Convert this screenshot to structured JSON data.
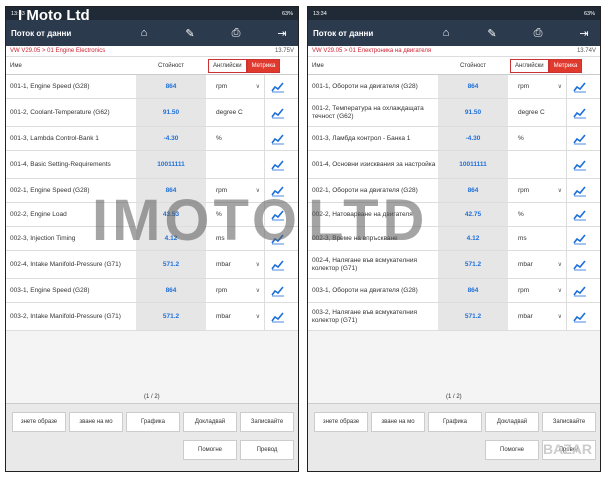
{
  "left": {
    "status_time": "13:33",
    "status_battery": "63%",
    "title": "Поток от данни",
    "crumb": "VW V29.05 > 01 Engine Electronics",
    "voltage": "13.75V",
    "header": {
      "name": "Име",
      "value": "Стойност",
      "english": "Английски",
      "metric": "Метрика"
    },
    "rows": [
      {
        "name": "001-1, Engine Speed (G28)",
        "value": "864",
        "unit": "rpm",
        "dropdown": true
      },
      {
        "name": "001-2, Coolant-Temperature (G62)",
        "value": "91.50",
        "unit": "degree C",
        "dropdown": false
      },
      {
        "name": "001-3, Lambda Control-Bank 1",
        "value": "-4.30",
        "unit": "%",
        "dropdown": false
      },
      {
        "name": "001-4, Basic Setting-Requirements",
        "value": "10011111",
        "unit": "",
        "dropdown": false
      },
      {
        "name": "002-1, Engine Speed (G28)",
        "value": "864",
        "unit": "rpm",
        "dropdown": true
      },
      {
        "name": "002-2, Engine Load",
        "value": "43.53",
        "unit": "%",
        "dropdown": false
      },
      {
        "name": "002-3, Injection Timing",
        "value": "4.12",
        "unit": "ms",
        "dropdown": false
      },
      {
        "name": "002-4, Intake Manifold-Pressure (G71)",
        "value": "571.2",
        "unit": "mbar",
        "dropdown": true
      },
      {
        "name": "003-1, Engine Speed (G28)",
        "value": "864",
        "unit": "rpm",
        "dropdown": true
      },
      {
        "name": "003-2, Intake Manifold-Pressure (G71)",
        "value": "571.2",
        "unit": "mbar",
        "dropdown": true
      }
    ],
    "page": "(1 / 2)",
    "buttons": [
      "знете образе",
      "зване на мо",
      "Графика",
      "Докладвай",
      "Записвайте",
      "Помогне",
      "Превод"
    ]
  },
  "right": {
    "status_time": "13:34",
    "status_battery": "63%",
    "title": "Поток от данни",
    "crumb": "VW V29.05 > 01 Електроника на двигателя",
    "voltage": "13.74V",
    "header": {
      "name": "Име",
      "value": "Стойност",
      "english": "Английски",
      "metric": "Метрика"
    },
    "rows": [
      {
        "name": "001-1, Обороти на двигателя (G28)",
        "value": "864",
        "unit": "rpm",
        "dropdown": true
      },
      {
        "name": "001-2, Температура на охлаждащата течност (G62)",
        "value": "91.50",
        "unit": "degree C",
        "dropdown": false
      },
      {
        "name": "001-3, Ламбда контрол - Банка 1",
        "value": "-4.30",
        "unit": "%",
        "dropdown": false
      },
      {
        "name": "001-4, Основни изисквания за настройка",
        "value": "10011111",
        "unit": "",
        "dropdown": false
      },
      {
        "name": "002-1, Обороти на двигателя (G28)",
        "value": "864",
        "unit": "rpm",
        "dropdown": true
      },
      {
        "name": "002-2, Натоварване на двигателя",
        "value": "42.75",
        "unit": "%",
        "dropdown": false
      },
      {
        "name": "002-3, Време на впръскване",
        "value": "4.12",
        "unit": "ms",
        "dropdown": false
      },
      {
        "name": "002-4, Налягане във всмукателния колектор (G71)",
        "value": "571.2",
        "unit": "mbar",
        "dropdown": true
      },
      {
        "name": "003-1, Обороти на двигателя (G28)",
        "value": "864",
        "unit": "rpm",
        "dropdown": true
      },
      {
        "name": "003-2, Налягане във всмукателния колектор (G71)",
        "value": "571.2",
        "unit": "mbar",
        "dropdown": true
      }
    ],
    "page": "(1 / 2)",
    "buttons": [
      "знете образе",
      "зване на мо",
      "Графика",
      "Докладвай",
      "Записвайте",
      "Помогне",
      "Превод"
    ]
  },
  "watermark": {
    "text": "IMOTO LTD",
    "logo": "I Moto Ltd"
  },
  "footer_mark": "BAZAR"
}
